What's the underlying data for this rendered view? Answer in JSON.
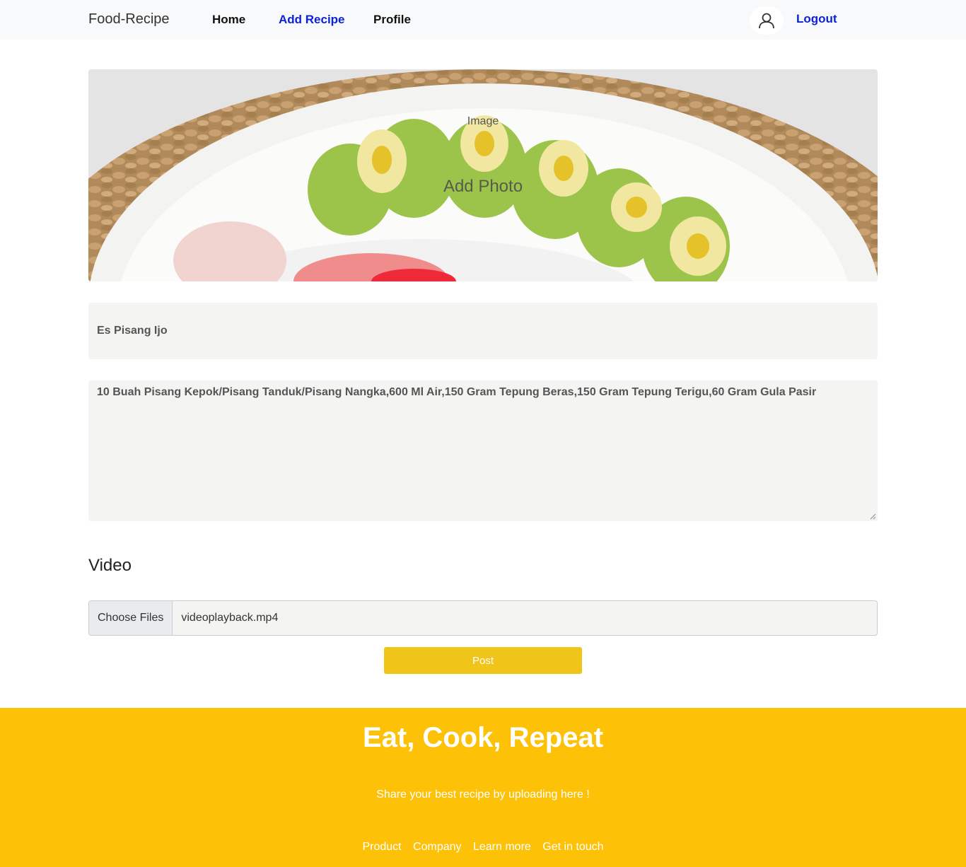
{
  "navbar": {
    "brand": "Food-Recipe",
    "links": [
      {
        "label": "Home"
      },
      {
        "label": "Add Recipe"
      },
      {
        "label": "Profile"
      }
    ],
    "logout": "Logout",
    "avatar_icon": "user-icon"
  },
  "photo": {
    "label_small": "Image",
    "label_big": "Add Photo"
  },
  "form": {
    "title_value": "Es Pisang Ijo",
    "ingredients_value": "10 Buah Pisang Kepok/Pisang Tanduk/Pisang Nangka,600 Ml Air,150 Gram Tepung Beras,150 Gram Tepung Terigu,60 Gram Gula Pasir",
    "video_heading": "Video",
    "file_button": "Choose Files",
    "file_name": "videoplayback.mp4",
    "post_button": "Post"
  },
  "footer": {
    "title": "Eat, Cook, Repeat",
    "subtitle": "Share your best recipe by uploading here !",
    "links": [
      "Product",
      "Company",
      "Learn more",
      "Get in touch"
    ]
  },
  "colors": {
    "accent_link": "#0a23d6",
    "post_button": "#f0c419",
    "footer_bg": "#fdc107"
  }
}
